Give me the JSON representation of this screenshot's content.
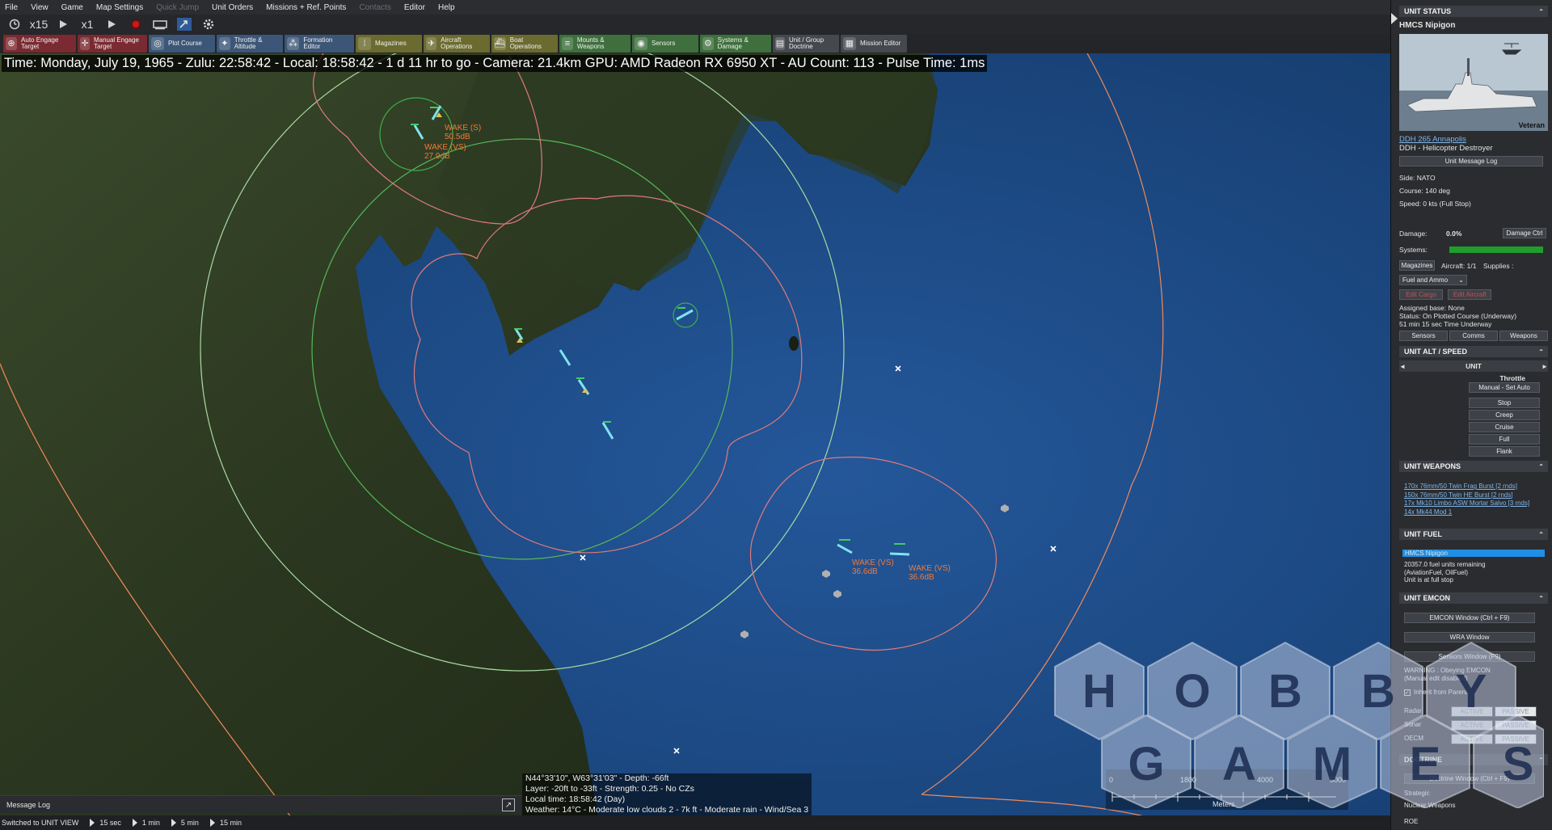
{
  "menu": {
    "items": [
      "File",
      "View",
      "Game",
      "Map Settings",
      "Quick Jump",
      "Unit Orders",
      "Missions + Ref. Points",
      "Contacts",
      "Editor",
      "Help"
    ],
    "disabled": [
      "Quick Jump",
      "Contacts"
    ]
  },
  "timebar": {
    "compression_left": "x15",
    "compression_right": "x1"
  },
  "toolbar": {
    "buttons": [
      {
        "label": "Auto Engage Target",
        "style": "red"
      },
      {
        "label": "Manual Engage Target",
        "style": "red"
      },
      {
        "label": "Plot Course",
        "style": "blue"
      },
      {
        "label": "Throttle & Altitude",
        "style": "blue"
      },
      {
        "label": "Formation Editor",
        "style": "blue"
      },
      {
        "label": "Magazines",
        "style": "olive"
      },
      {
        "label": "Aircraft Operations",
        "style": "olive"
      },
      {
        "label": "Boat Operations",
        "style": "olive"
      },
      {
        "label": "Mounts & Weapons",
        "style": "green"
      },
      {
        "label": "Sensors",
        "style": "green"
      },
      {
        "label": "Systems & Damage",
        "style": "green"
      },
      {
        "label": "Unit / Group Doctrine",
        "style": "grey"
      },
      {
        "label": "Mission Editor",
        "style": "grey"
      }
    ]
  },
  "status_line": "Time: Monday, July 19, 1965 - Zulu: 22:58:42 - Local: 18:58:42 - 1 d 11 hr to go - Camera: 21.4km GPU: AMD Radeon RX 6950 XT - AU Count: 113 - Pulse Time: 1ms",
  "contacts": [
    {
      "label": "WAKE (S)",
      "value": "50.5dB"
    },
    {
      "label": "WAKE (VS)",
      "value": "27.9dB"
    },
    {
      "label": "WAKE (VS)",
      "value": "36.6dB"
    },
    {
      "label": "WAKE (VS)",
      "value": "36.6dB"
    }
  ],
  "readout": {
    "line1": "N44°33'10\", W63°31'03\" - Depth: -66ft",
    "line2": "Layer: -20ft to -33ft - Strength: 0.25 - No CZs",
    "line3": "Local time: 18:58:42 (Day)",
    "line4": "Weather: 14°C - Moderate low clouds 2 - 7k ft - Moderate rain - Wind/Sea 3"
  },
  "scalebar": {
    "ticks": [
      "0",
      "1800",
      "4000",
      "5000"
    ],
    "unit": "Meters"
  },
  "message_log": {
    "title": "Message Log"
  },
  "bottombar": {
    "status": "Switched to UNIT VIEW",
    "steps": [
      "15 sec",
      "1 min",
      "5 min",
      "15 min"
    ]
  },
  "panel": {
    "unit_status_title": "UNIT STATUS",
    "unit_name": "HMCS Nipigon",
    "proficiency": "Veteran",
    "class_link": "DDH 265 Annapolis",
    "class_type": "DDH - Helicopter Destroyer",
    "msg_log_btn": "Unit Message Log",
    "side": "Side: NATO",
    "course": "Course: 140 deg",
    "speed": "Speed: 0 kts (Full Stop)",
    "damage_label": "Damage:",
    "damage_value": "0.0%",
    "damage_ctrl": "Damage Ctrl",
    "systems_label": "Systems:",
    "systems_health": 1.0,
    "magazines_btn": "Magazines",
    "aircraft_label": "Aircraft: 1/1",
    "supplies_label": "Supplies :",
    "supplies_select": "Fuel and Ammo",
    "edit_cargo": "Edit Cargo",
    "edit_aircraft": "Edit Aircraft",
    "assigned_base": "Assigned base: None",
    "status_text": "Status: On Plotted Course (Underway)",
    "time_underway": "51 min 15 sec Time Underway",
    "tabs": [
      "Sensors",
      "Comms",
      "Weapons"
    ],
    "alt_speed_title": "UNIT ALT / SPEED",
    "alt_unit": "UNIT",
    "throttle_label": "Throttle",
    "throttle_mode": "Manual - Set Auto",
    "throttle_buttons": [
      "Stop",
      "Creep",
      "Cruise",
      "Full",
      "Flank"
    ],
    "weapons_title": "UNIT WEAPONS",
    "weapons": [
      "170x 76mm/50 Twin Frag Burst [2 rnds]",
      "150x 76mm/50 Twin HE Burst [2 rnds]",
      "17x Mk10 Limbo ASW Mortar Salvo [3 rnds]",
      "14x Mk44 Mod 1"
    ],
    "fuel_title": "UNIT FUEL",
    "fuel_unit": "HMCS Nipigon",
    "fuel_line1": "20357.0 fuel units remaining",
    "fuel_line2": "(AviationFuel, OilFuel)",
    "fuel_line3": "Unit is at full stop",
    "emcon_title": "UNIT EMCON",
    "emcon_window": "EMCON Window (Ctrl + F9)",
    "wra_window": "WRA Window",
    "sensors_window": "Sensors Window (F9)",
    "warning1": "WARNING : Obeying EMCON",
    "warning2": "(Manual edit disabled)",
    "inherit": "Inherit from Parent",
    "emcon_rows": [
      "Radar",
      "Sonar",
      "OECM"
    ],
    "active": "ACTIVE",
    "passive": "PASSIVE",
    "doctrine_title": "DOCTRINE",
    "doctrine_window": "Doctrine Window (Ctrl + F9)",
    "strategic": "Strategic",
    "nuclear": "Nuclear Weapons",
    "roe": "ROE"
  },
  "watermark": {
    "line1": "HOBBY",
    "line2": "GAMES",
    "letters1": [
      "H",
      "O",
      "B",
      "B",
      "Y"
    ],
    "letters2": [
      "G",
      "A",
      "M",
      "E",
      "S"
    ]
  },
  "colors": {
    "sea": "#1f4d86",
    "land": "#2f3b22",
    "friendly_ring": "#3fae4c",
    "hostile_ring": "#e07a7a",
    "range_ring": "#f08a5a",
    "contact_text": "#f07a37",
    "unit_icon": "#7fe3f0"
  }
}
